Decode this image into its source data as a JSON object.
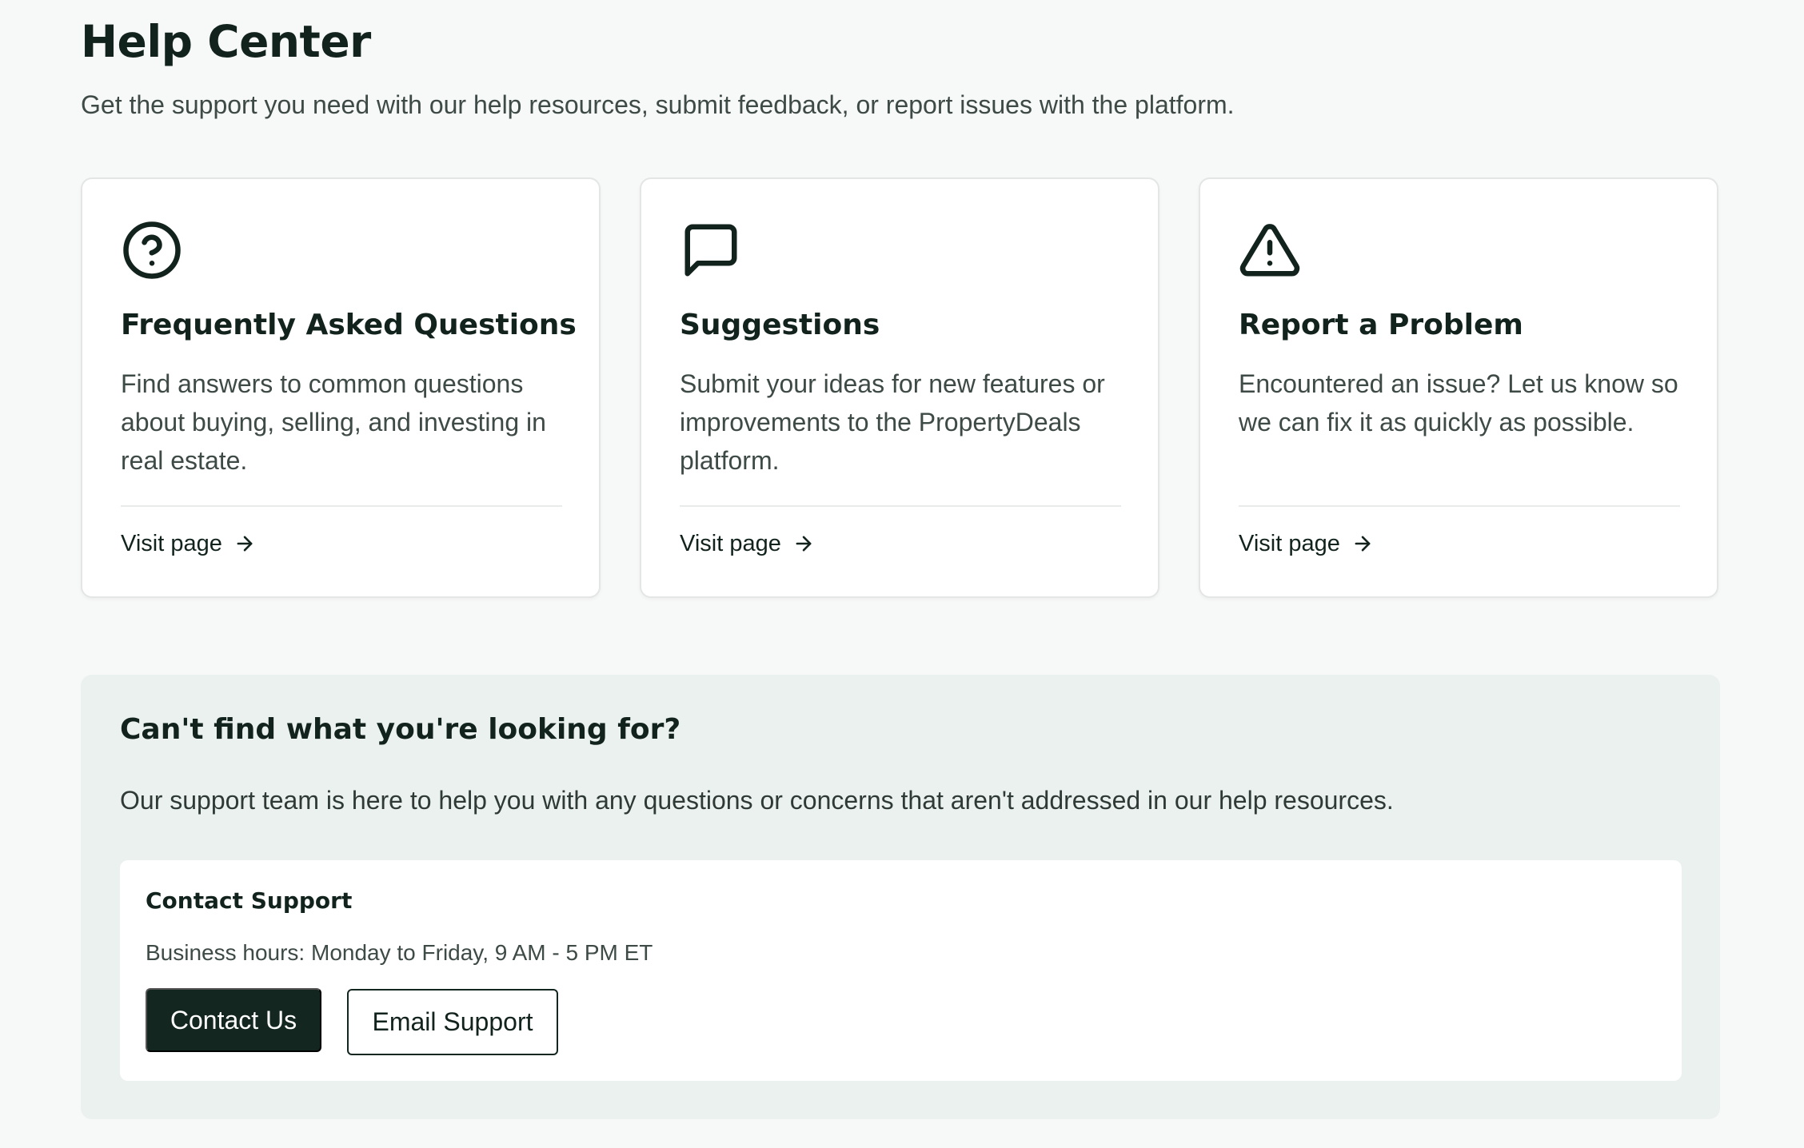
{
  "header": {
    "title": "Help Center",
    "subtitle": "Get the support you need with our help resources, submit feedback, or report issues with the platform."
  },
  "cards": [
    {
      "icon": "question-circle-icon",
      "title": "Frequently Asked Questions",
      "description": "Find answers to common questions about buying, selling, and investing in real estate.",
      "link_label": "Visit page"
    },
    {
      "icon": "message-square-icon",
      "title": "Suggestions",
      "description": "Submit your ideas for new features or improvements to the PropertyDeals platform.",
      "link_label": "Visit page"
    },
    {
      "icon": "alert-triangle-icon",
      "title": "Report a Problem",
      "description": "Encountered an issue? Let us know so we can fix it as quickly as possible.",
      "link_label": "Visit page"
    }
  ],
  "help_panel": {
    "title": "Can't find what you're looking for?",
    "description": "Our support team is here to help you with any questions or concerns that aren't addressed in our help resources.",
    "contact": {
      "title": "Contact Support",
      "hours": "Business hours: Monday to Friday, 9 AM - 5 PM ET",
      "primary_button": "Contact Us",
      "secondary_button": "Email Support"
    }
  },
  "colors": {
    "background": "#f7f8f8",
    "text_dark": "#12231d",
    "panel_bg": "#ebf1ef",
    "button_primary": "#142620"
  }
}
